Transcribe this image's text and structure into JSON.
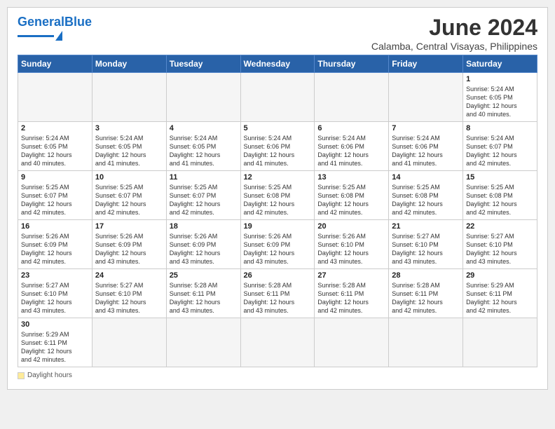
{
  "header": {
    "logo_general": "General",
    "logo_blue": "Blue",
    "main_title": "June 2024",
    "subtitle": "Calamba, Central Visayas, Philippines"
  },
  "days_of_week": [
    "Sunday",
    "Monday",
    "Tuesday",
    "Wednesday",
    "Thursday",
    "Friday",
    "Saturday"
  ],
  "weeks": [
    [
      {
        "num": "",
        "info": ""
      },
      {
        "num": "",
        "info": ""
      },
      {
        "num": "",
        "info": ""
      },
      {
        "num": "",
        "info": ""
      },
      {
        "num": "",
        "info": ""
      },
      {
        "num": "",
        "info": ""
      },
      {
        "num": "1",
        "info": "Sunrise: 5:24 AM\nSunset: 6:05 PM\nDaylight: 12 hours\nand 40 minutes."
      }
    ],
    [
      {
        "num": "2",
        "info": "Sunrise: 5:24 AM\nSunset: 6:05 PM\nDaylight: 12 hours\nand 40 minutes."
      },
      {
        "num": "3",
        "info": "Sunrise: 5:24 AM\nSunset: 6:05 PM\nDaylight: 12 hours\nand 41 minutes."
      },
      {
        "num": "4",
        "info": "Sunrise: 5:24 AM\nSunset: 6:05 PM\nDaylight: 12 hours\nand 41 minutes."
      },
      {
        "num": "5",
        "info": "Sunrise: 5:24 AM\nSunset: 6:06 PM\nDaylight: 12 hours\nand 41 minutes."
      },
      {
        "num": "6",
        "info": "Sunrise: 5:24 AM\nSunset: 6:06 PM\nDaylight: 12 hours\nand 41 minutes."
      },
      {
        "num": "7",
        "info": "Sunrise: 5:24 AM\nSunset: 6:06 PM\nDaylight: 12 hours\nand 41 minutes."
      },
      {
        "num": "8",
        "info": "Sunrise: 5:24 AM\nSunset: 6:07 PM\nDaylight: 12 hours\nand 42 minutes."
      }
    ],
    [
      {
        "num": "9",
        "info": "Sunrise: 5:25 AM\nSunset: 6:07 PM\nDaylight: 12 hours\nand 42 minutes."
      },
      {
        "num": "10",
        "info": "Sunrise: 5:25 AM\nSunset: 6:07 PM\nDaylight: 12 hours\nand 42 minutes."
      },
      {
        "num": "11",
        "info": "Sunrise: 5:25 AM\nSunset: 6:07 PM\nDaylight: 12 hours\nand 42 minutes."
      },
      {
        "num": "12",
        "info": "Sunrise: 5:25 AM\nSunset: 6:08 PM\nDaylight: 12 hours\nand 42 minutes."
      },
      {
        "num": "13",
        "info": "Sunrise: 5:25 AM\nSunset: 6:08 PM\nDaylight: 12 hours\nand 42 minutes."
      },
      {
        "num": "14",
        "info": "Sunrise: 5:25 AM\nSunset: 6:08 PM\nDaylight: 12 hours\nand 42 minutes."
      },
      {
        "num": "15",
        "info": "Sunrise: 5:25 AM\nSunset: 6:08 PM\nDaylight: 12 hours\nand 42 minutes."
      }
    ],
    [
      {
        "num": "16",
        "info": "Sunrise: 5:26 AM\nSunset: 6:09 PM\nDaylight: 12 hours\nand 42 minutes."
      },
      {
        "num": "17",
        "info": "Sunrise: 5:26 AM\nSunset: 6:09 PM\nDaylight: 12 hours\nand 43 minutes."
      },
      {
        "num": "18",
        "info": "Sunrise: 5:26 AM\nSunset: 6:09 PM\nDaylight: 12 hours\nand 43 minutes."
      },
      {
        "num": "19",
        "info": "Sunrise: 5:26 AM\nSunset: 6:09 PM\nDaylight: 12 hours\nand 43 minutes."
      },
      {
        "num": "20",
        "info": "Sunrise: 5:26 AM\nSunset: 6:10 PM\nDaylight: 12 hours\nand 43 minutes."
      },
      {
        "num": "21",
        "info": "Sunrise: 5:27 AM\nSunset: 6:10 PM\nDaylight: 12 hours\nand 43 minutes."
      },
      {
        "num": "22",
        "info": "Sunrise: 5:27 AM\nSunset: 6:10 PM\nDaylight: 12 hours\nand 43 minutes."
      }
    ],
    [
      {
        "num": "23",
        "info": "Sunrise: 5:27 AM\nSunset: 6:10 PM\nDaylight: 12 hours\nand 43 minutes."
      },
      {
        "num": "24",
        "info": "Sunrise: 5:27 AM\nSunset: 6:10 PM\nDaylight: 12 hours\nand 43 minutes."
      },
      {
        "num": "25",
        "info": "Sunrise: 5:28 AM\nSunset: 6:11 PM\nDaylight: 12 hours\nand 43 minutes."
      },
      {
        "num": "26",
        "info": "Sunrise: 5:28 AM\nSunset: 6:11 PM\nDaylight: 12 hours\nand 43 minutes."
      },
      {
        "num": "27",
        "info": "Sunrise: 5:28 AM\nSunset: 6:11 PM\nDaylight: 12 hours\nand 42 minutes."
      },
      {
        "num": "28",
        "info": "Sunrise: 5:28 AM\nSunset: 6:11 PM\nDaylight: 12 hours\nand 42 minutes."
      },
      {
        "num": "29",
        "info": "Sunrise: 5:29 AM\nSunset: 6:11 PM\nDaylight: 12 hours\nand 42 minutes."
      }
    ],
    [
      {
        "num": "30",
        "info": "Sunrise: 5:29 AM\nSunset: 6:11 PM\nDaylight: 12 hours\nand 42 minutes."
      },
      {
        "num": "",
        "info": ""
      },
      {
        "num": "",
        "info": ""
      },
      {
        "num": "",
        "info": ""
      },
      {
        "num": "",
        "info": ""
      },
      {
        "num": "",
        "info": ""
      },
      {
        "num": "",
        "info": ""
      }
    ]
  ],
  "footer": {
    "daylight_label": "Daylight hours"
  }
}
